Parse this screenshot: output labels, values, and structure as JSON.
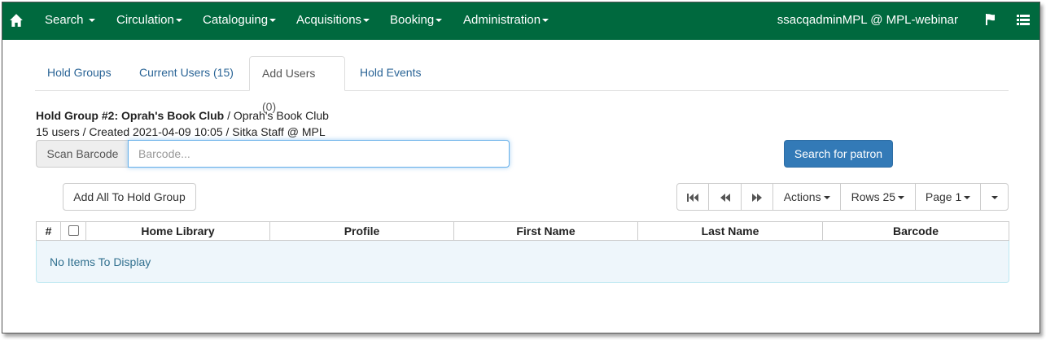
{
  "navbar": {
    "menus": [
      "Search",
      "Circulation",
      "Cataloguing",
      "Acquisitions",
      "Booking",
      "Administration"
    ],
    "user": "ssacqadminMPL @ MPL-webinar",
    "icons": [
      "home-icon",
      "flag-icon",
      "list-icon"
    ]
  },
  "tabs": [
    "Hold Groups",
    "Current Users (15)",
    "Add Users (0)",
    "Hold Events"
  ],
  "active_tab": "Add Users (0)",
  "hold_group": {
    "title": "Hold Group #2: Oprah's Book Club",
    "subtitle": " / Oprah's Book Club",
    "details": "15 users / Created 2021-04-09 10:05 / Sitka Staff @ MPL"
  },
  "scan": {
    "addon_label": "Scan Barcode",
    "placeholder": "Barcode...",
    "search_button": "Search for patron"
  },
  "toolbar": {
    "add_all": "Add All To Hold Group",
    "actions": "Actions",
    "rows": "Rows 25",
    "page": "Page 1"
  },
  "table": {
    "columns": [
      "#",
      "",
      "Home Library",
      "Profile",
      "First Name",
      "Last Name",
      "Barcode"
    ],
    "empty_message": "No Items To Display"
  },
  "colors": {
    "navbar": "#00693e",
    "primary": "#337ab7",
    "link": "#2a6496"
  }
}
